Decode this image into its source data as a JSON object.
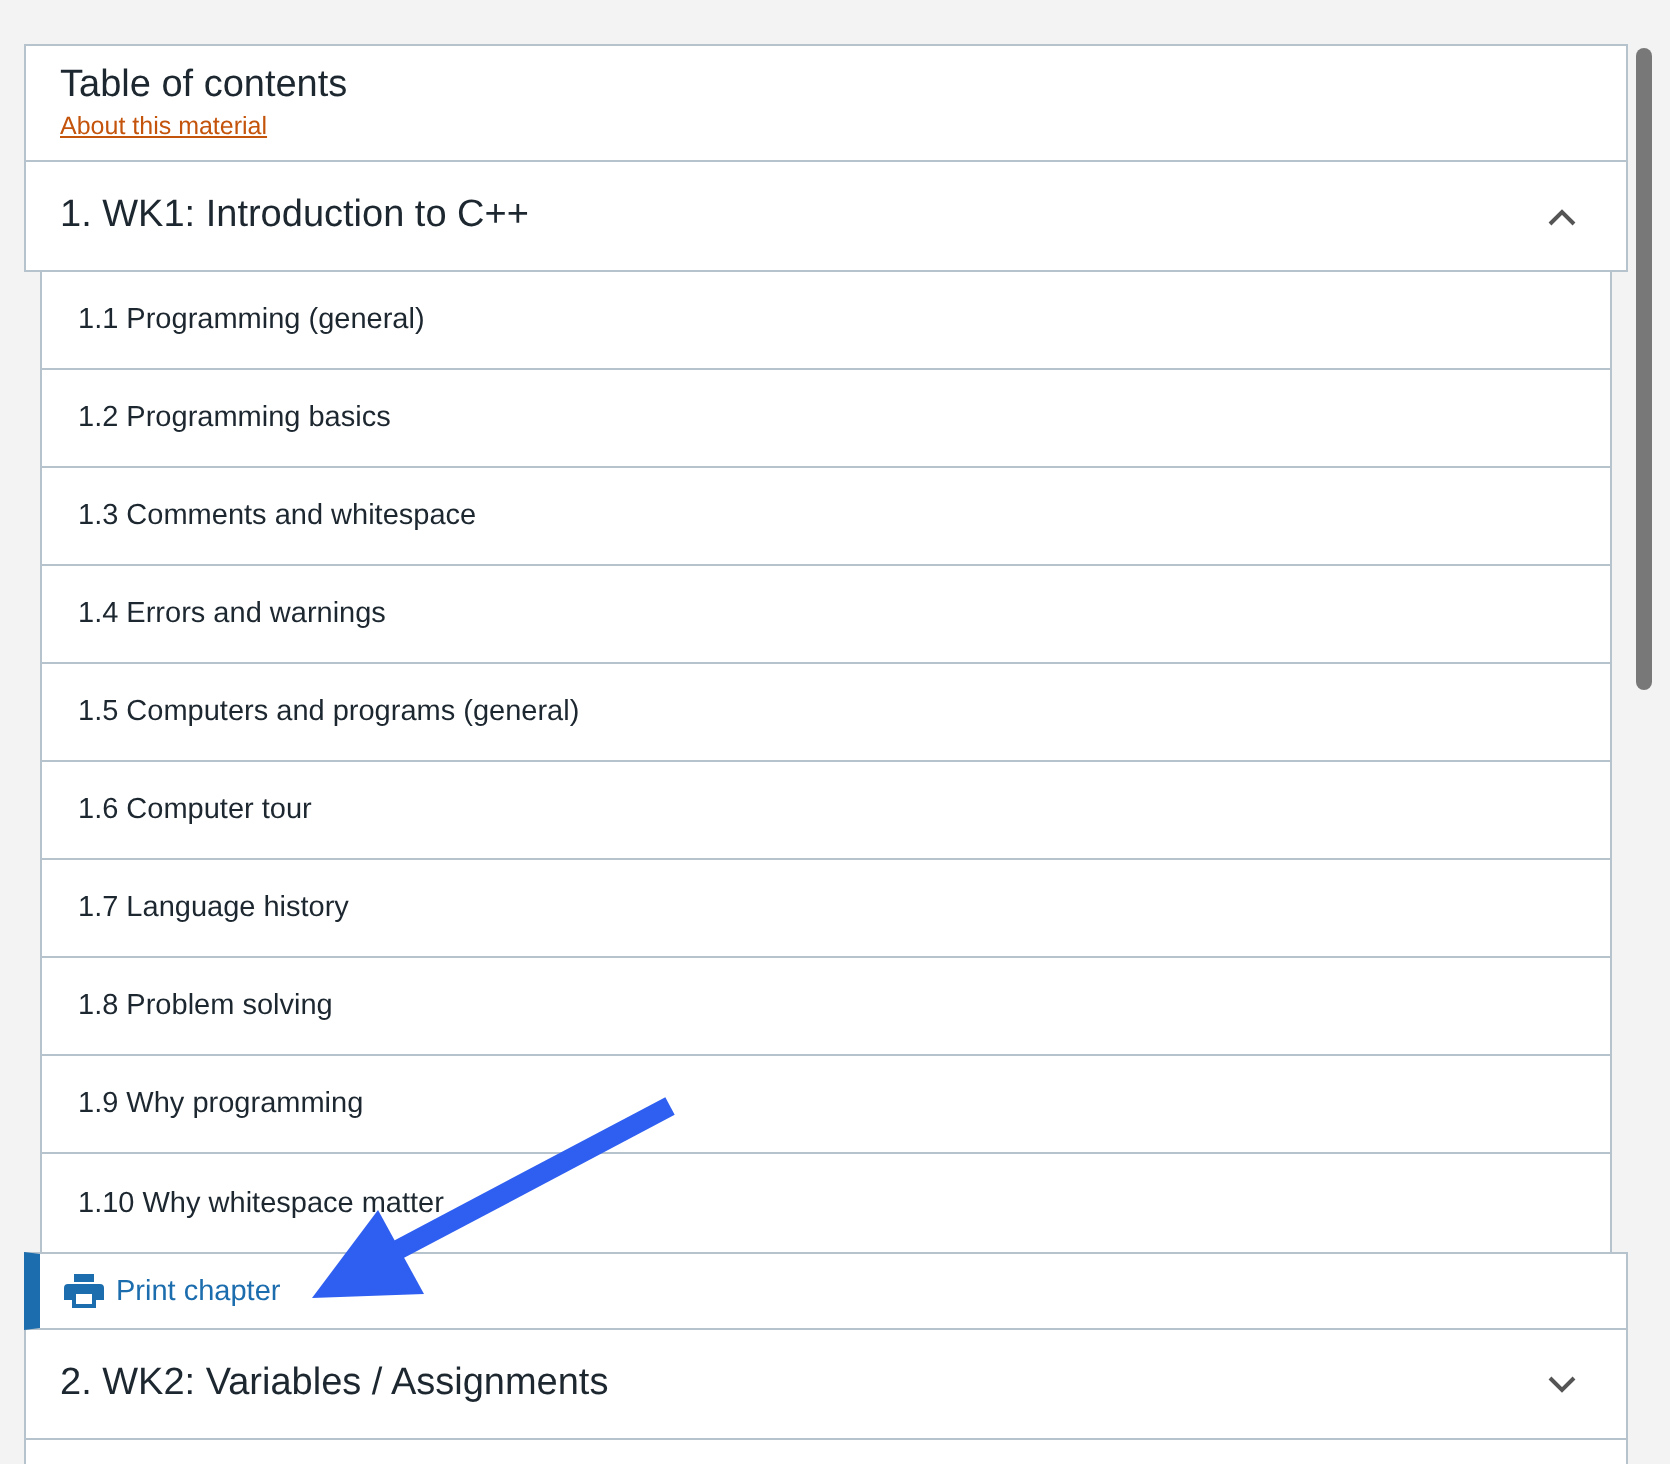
{
  "toc": {
    "title": "Table of contents",
    "about_link": "About this material"
  },
  "chapters": [
    {
      "title": "1. WK1: Introduction to C++",
      "expanded": true,
      "sections": [
        "1.1 Programming (general)",
        "1.2 Programming basics",
        "1.3 Comments and whitespace",
        "1.4 Errors and warnings",
        "1.5 Computers and programs (general)",
        "1.6 Computer tour",
        "1.7 Language history",
        "1.8 Problem solving",
        "1.9 Why programming",
        "1.10 Why whitespace matter"
      ],
      "print_label": "Print chapter"
    },
    {
      "title": "2. WK2: Variables / Assignments",
      "expanded": false
    }
  ]
}
